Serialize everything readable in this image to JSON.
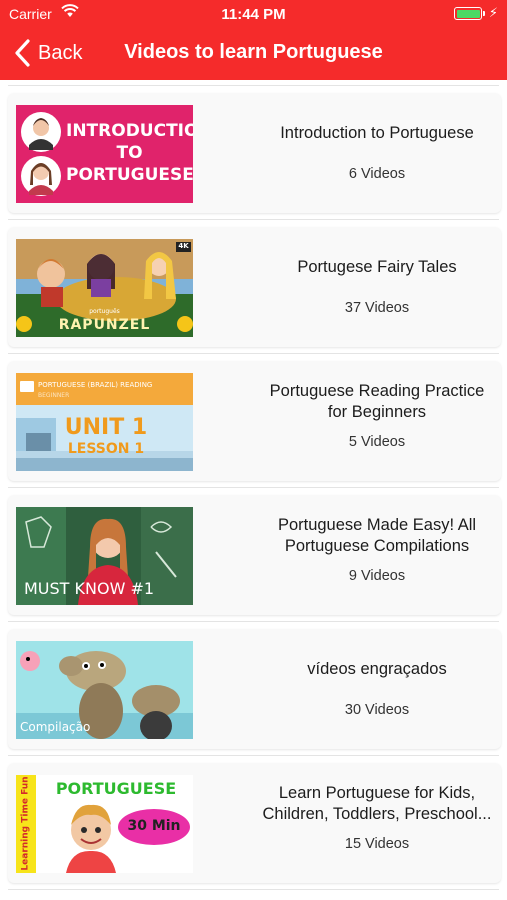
{
  "status_bar": {
    "carrier": "Carrier",
    "time": "11:44 PM",
    "battery_color": "#4cd964"
  },
  "navbar": {
    "back_label": "Back",
    "title": "Videos to learn Portuguese",
    "background": "#f52b2b"
  },
  "playlists": [
    {
      "title_lines": [
        "Introduction to Portuguese"
      ],
      "count": "6 Videos",
      "thumb": {
        "line1": "INTRODUCTION",
        "line2": "TO",
        "line3": "PORTUGUESE"
      }
    },
    {
      "title_lines": [
        "Portugese Fairy Tales"
      ],
      "count": "37 Videos",
      "thumb": {
        "badge": "4K",
        "small": "português",
        "big": "RAPUNZEL"
      }
    },
    {
      "title_lines": [
        "Portuguese Reading Practice",
        "for Beginners"
      ],
      "count": "5 Videos",
      "thumb": {
        "banner": "PORTUGUESE (BRAZIL) READING",
        "level": "BEGINNER",
        "unit": "UNIT 1",
        "lesson": "LESSON 1"
      }
    },
    {
      "title_lines": [
        "Portuguese Made Easy! All",
        "Portuguese Compilations"
      ],
      "count": "9 Videos",
      "thumb": {
        "caption": "MUST KNOW #1"
      }
    },
    {
      "title_lines": [
        "vídeos engraçados"
      ],
      "count": "30 Videos",
      "thumb": {
        "caption": "Compilação"
      }
    },
    {
      "title_lines": [
        "Learn Portuguese for Kids,",
        "Children, Toddlers, Preschool..."
      ],
      "count": "15 Videos",
      "thumb": {
        "side": "Learning Time Fun",
        "big": "PORTUGUESE",
        "badge": "30 Min"
      }
    }
  ]
}
